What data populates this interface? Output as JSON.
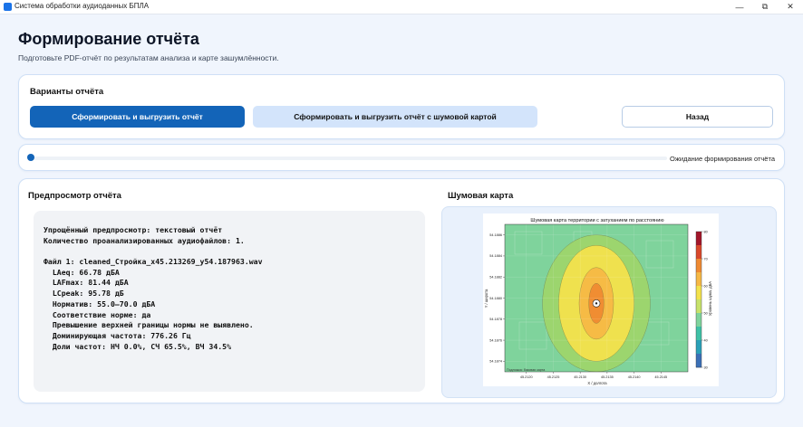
{
  "window": {
    "title": "Система обработки аудиоданных БПЛА",
    "minimize_glyph": "—",
    "maximize_glyph": "⧉",
    "close_glyph": "✕"
  },
  "header": {
    "title": "Формирование отчёта",
    "subtitle": "Подготовьте PDF-отчёт по результатам анализа и карте зашумлённости."
  },
  "variants": {
    "title": "Варианты отчёта",
    "btn_export": "Сформировать и выгрузить отчёт",
    "btn_export_map": "Сформировать и выгрузить отчёт с шумовой картой",
    "btn_back": "Назад"
  },
  "progress": {
    "value": 0,
    "status": "Ожидание формирования отчёта"
  },
  "preview": {
    "title": "Предпросмотр отчёта",
    "lines": [
      "Упрощённый предпросмотр: текстовый отчёт",
      "Количество проанализированных аудиофайлов: 1.",
      "",
      "Файл 1: cleaned_Стройка_x45.213269_y54.187963.wav",
      "  LAeq: 66.78 дБА",
      "  LAFmax: 81.44 дБА",
      "  LCpeak: 95.78 дБ",
      "  Норматив: 55.0–70.0 дБА",
      "  Соответствие норме: да",
      "  Превышение верхней границы нормы не выявлено.",
      "  Доминирующая частота: 776.26 Гц",
      "  Доли частот: НЧ 0.0%, СЧ 65.5%, ВЧ 34.5%"
    ]
  },
  "noise_map": {
    "title": "Шумовая карта",
    "chart_data": {
      "type": "heatmap",
      "title": "Шумовая карта территории с затуханием по расстоянию",
      "xlabel": "X / долгота",
      "ylabel": "Y / широта",
      "x_ticks": [
        "45.2120",
        "45.2125",
        "45.2130",
        "45.2135",
        "45.2140",
        "45.2145"
      ],
      "y_ticks": [
        "54.1886",
        "54.1884",
        "54.1882",
        "54.1880",
        "54.1878",
        "54.1876",
        "54.1874"
      ],
      "colorbar_label": "Уровень шума, дБА",
      "colorbar_ticks": [
        "80",
        "70",
        "60",
        "50",
        "40",
        "30"
      ],
      "colorbar_range": [
        30,
        80
      ],
      "source": {
        "x": 45.2133,
        "y": 54.18795
      },
      "contours": [
        {
          "level": 50,
          "color": "#9ed56b",
          "rx": 0.001,
          "ry": 0.00065
        },
        {
          "level": 55,
          "color": "#f3e24c",
          "rx": 0.0007,
          "ry": 0.00055
        },
        {
          "level": 60,
          "color": "#f6b845",
          "rx": 0.00032,
          "ry": 0.00034
        },
        {
          "level": 65,
          "color": "#ef8a32",
          "rx": 0.00014,
          "ry": 0.00019
        }
      ],
      "background_level_color": "#7fd39c",
      "attribution": "Подложка: базовая карта"
    }
  }
}
